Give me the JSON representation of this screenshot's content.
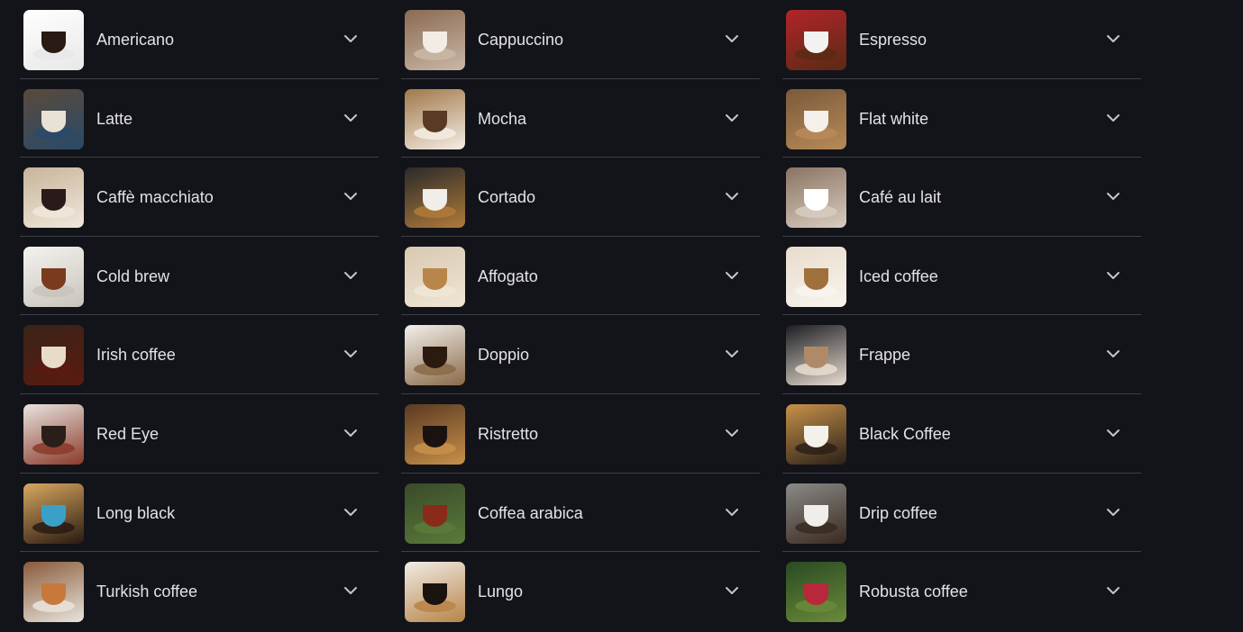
{
  "items": [
    {
      "label": "Americano",
      "thumb": {
        "bg": "#ffffff",
        "fg": "#2a1a14",
        "accent": "#e8e8e8"
      }
    },
    {
      "label": "Cappuccino",
      "thumb": {
        "bg": "#8a6a52",
        "fg": "#f2ece4",
        "accent": "#c9b8a6"
      }
    },
    {
      "label": "Espresso",
      "thumb": {
        "bg": "#b2242a",
        "fg": "#f4f2f0",
        "accent": "#5a2a14"
      }
    },
    {
      "label": "Latte",
      "thumb": {
        "bg": "#5a4a3a",
        "fg": "#e8e2d6",
        "accent": "#2a4a6a"
      }
    },
    {
      "label": "Mocha",
      "thumb": {
        "bg": "#a0784a",
        "fg": "#5a3a22",
        "accent": "#f4ede4"
      }
    },
    {
      "label": "Flat white",
      "thumb": {
        "bg": "#7a5a3a",
        "fg": "#f5f1ea",
        "accent": "#b88a58"
      }
    },
    {
      "label": "Caffè macchiato",
      "thumb": {
        "bg": "#c8b49a",
        "fg": "#2a1a1a",
        "accent": "#f0e8dc"
      }
    },
    {
      "label": "Cortado",
      "thumb": {
        "bg": "#2a2a2a",
        "fg": "#f0eee8",
        "accent": "#b07a3a"
      }
    },
    {
      "label": "Café au lait",
      "thumb": {
        "bg": "#8a7462",
        "fg": "#ffffff",
        "accent": "#d8ccc0"
      }
    },
    {
      "label": "Cold brew",
      "thumb": {
        "bg": "#f4f2ee",
        "fg": "#7a3a1e",
        "accent": "#c8c4bc"
      }
    },
    {
      "label": "Affogato",
      "thumb": {
        "bg": "#d8c8b0",
        "fg": "#b8864a",
        "accent": "#f0e6d6"
      }
    },
    {
      "label": "Iced coffee",
      "thumb": {
        "bg": "#e8dccc",
        "fg": "#a0703a",
        "accent": "#f8f4ee"
      }
    },
    {
      "label": "Irish coffee",
      "thumb": {
        "bg": "#3a2418",
        "fg": "#e8dcc8",
        "accent": "#5a1a10"
      }
    },
    {
      "label": "Doppio",
      "thumb": {
        "bg": "#f2f0ec",
        "fg": "#2a1a10",
        "accent": "#8a6a48"
      }
    },
    {
      "label": "Frappe",
      "thumb": {
        "bg": "#1c1d23",
        "fg": "#b08a68",
        "accent": "#e8ddd0"
      }
    },
    {
      "label": "Red Eye",
      "thumb": {
        "bg": "#e8e4e0",
        "fg": "#2a1e18",
        "accent": "#8a3a2a"
      }
    },
    {
      "label": "Ristretto",
      "thumb": {
        "bg": "#5a3a22",
        "fg": "#1a1210",
        "accent": "#c8904a"
      }
    },
    {
      "label": "Black Coffee",
      "thumb": {
        "bg": "#c8924a",
        "fg": "#f4f0ea",
        "accent": "#2a2018"
      }
    },
    {
      "label": "Long black",
      "thumb": {
        "bg": "#d8a860",
        "fg": "#3aa0c8",
        "accent": "#2a1a12"
      }
    },
    {
      "label": "Coffea arabica",
      "thumb": {
        "bg": "#3a4a2a",
        "fg": "#8a2a1a",
        "accent": "#5a7a3a"
      }
    },
    {
      "label": "Drip coffee",
      "thumb": {
        "bg": "#8a8a88",
        "fg": "#f0eeea",
        "accent": "#3a2a20"
      }
    },
    {
      "label": "Turkish coffee",
      "thumb": {
        "bg": "#8a5a3a",
        "fg": "#c8783a",
        "accent": "#e8e4dc"
      }
    },
    {
      "label": "Lungo",
      "thumb": {
        "bg": "#f0ece6",
        "fg": "#1a1410",
        "accent": "#b88448"
      }
    },
    {
      "label": "Robusta coffee",
      "thumb": {
        "bg": "#2a4a22",
        "fg": "#b8283a",
        "accent": "#6a8a3a"
      }
    }
  ]
}
